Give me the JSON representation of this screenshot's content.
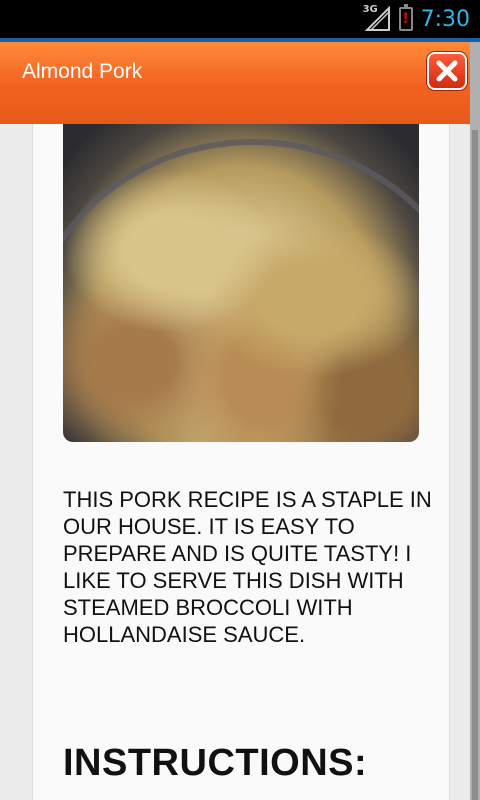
{
  "status_bar": {
    "network_label": "3G",
    "time": "7:30"
  },
  "action_bar": {
    "title": "Almond Pork",
    "close_icon": "close-x-icon"
  },
  "recipe": {
    "photo_alt": "photo of almond pork dish",
    "description": "THIS PORK RECIPE IS A STAPLE IN OUR HOUSE. IT IS EASY TO PREPARE AND IS QUITE TASTY! I LIKE TO SERVE THIS DISH WITH STEAMED BROCCOLI WITH HOLLANDAISE SAUCE.",
    "instructions_heading": "INSTRUCTIONS:"
  },
  "colors": {
    "action_bar": "#f2611f",
    "status_accent": "#33b5e5",
    "close_button": "#e0401f"
  }
}
